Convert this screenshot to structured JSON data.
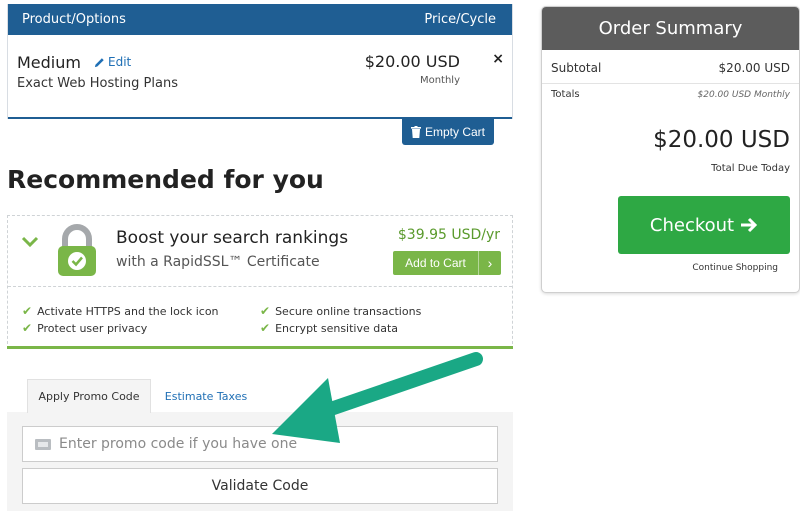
{
  "cart": {
    "header_product": "Product/Options",
    "header_price": "Price/Cycle",
    "item_name": "Medium",
    "edit_label": "Edit",
    "item_desc": "Exact Web Hosting Plans",
    "item_price": "$20.00 USD",
    "item_cycle": "Monthly",
    "remove_label": "×",
    "empty_cart_label": "Empty Cart"
  },
  "recommended": {
    "title": "Recommended for you",
    "headline": "Boost your search rankings",
    "subline": "with a RapidSSL™ Certificate",
    "price": "$39.95 USD/yr",
    "add_to_cart_label": "Add to Cart",
    "features": [
      "Activate HTTPS and the lock icon",
      "Protect user privacy",
      "Secure online transactions",
      "Encrypt sensitive data"
    ]
  },
  "tabs": {
    "active": "Apply Promo Code",
    "inactive": "Estimate Taxes"
  },
  "promo": {
    "placeholder": "Enter promo code if you have one",
    "validate_label": "Validate Code"
  },
  "summary": {
    "title": "Order Summary",
    "subtotal_label": "Subtotal",
    "subtotal_value": "$20.00 USD",
    "totals_label": "Totals",
    "totals_value": "$20.00 USD Monthly",
    "total_due": "$20.00 USD",
    "total_due_label": "Total Due Today",
    "checkout_label": "Checkout",
    "continue_label": "Continue Shopping"
  },
  "colors": {
    "brand_blue": "#1f5e93",
    "accent_green": "#7ab648",
    "checkout_green": "#2ea844",
    "annotation_arrow": "#1aa885"
  },
  "icons": {
    "edit": "pencil-icon",
    "empty_cart": "trash-icon",
    "promo_expand": "chevron-down-icon",
    "ssl": "lock-icon",
    "add_to_cart": "chevron-right-icon",
    "feature": "check-icon",
    "promo_input": "ticket-icon",
    "checkout": "arrow-right-icon"
  }
}
